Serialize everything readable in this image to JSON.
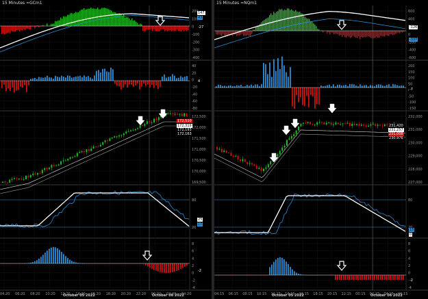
{
  "window": {
    "left_title": "15 Minutes =GCm1",
    "right_title": "15 Minutes =NQm1"
  },
  "left": {
    "axis_times": [
      "04:20",
      "06:20",
      "08:20",
      "10:20",
      "12:20",
      "14:20",
      "16:20",
      "18:20",
      "20:20",
      "22:20",
      "00:20",
      "02:20",
      "04:20"
    ],
    "dates": [
      "October 05 2022",
      "October 06 2022"
    ],
    "p1_ticks": [
      "200",
      "100",
      "0",
      "-100",
      "-200",
      "-300",
      "-400"
    ],
    "p1_tags": [
      "147",
      "43",
      "-27"
    ],
    "p2_ticks": [
      "40",
      "20",
      "0",
      "-20",
      "-40",
      "-60",
      "-80"
    ],
    "p2_tag": "4",
    "p3_ticks": [
      "172,500",
      "172,000",
      "171,500",
      "171,000",
      "170,500",
      "170,000",
      "169,500"
    ],
    "p3_tags": [
      "172,510",
      "172,319",
      "172,193",
      "172,163"
    ],
    "p4_ticks": [
      "80",
      "20"
    ],
    "p4_tags": [
      "25",
      "17"
    ],
    "p5_ticks": [
      "8",
      "6",
      "4",
      "2",
      "0",
      "-2",
      "-4"
    ],
    "p5_tag": "-2"
  },
  "right": {
    "axis_times": [
      "04:15",
      "06:15",
      "08:15",
      "10:15",
      "12:15",
      "14:15",
      "16:15",
      "18:15",
      "20:15",
      "22:15",
      "00:15",
      "02:15",
      "04:15",
      "06:15"
    ],
    "dates": [
      "October 05 2022",
      "October 06 2022"
    ],
    "p1_ticks": [
      "600",
      "400",
      "200",
      "0",
      "-200",
      "-400",
      "-600"
    ],
    "p1_tags": [
      "-126",
      "-337"
    ],
    "p2_ticks": [
      "200",
      "150",
      "100",
      "50",
      "0",
      "-50",
      "-100",
      "-150"
    ],
    "p2_tag": "-7",
    "p3_ticks": [
      "232,000",
      "231,000",
      "230,000",
      "229,000",
      "228,000",
      "227,000"
    ],
    "p3_tags": [
      "231,420",
      "231,257",
      "231,008",
      "230,976"
    ],
    "p4_ticks": [
      "80",
      "20"
    ],
    "p4_tags": [
      "15",
      "0"
    ],
    "p5_ticks": [
      "8",
      "6",
      "4",
      "2",
      "0",
      "-2",
      "-4"
    ],
    "p5_tag": "-2"
  },
  "colors": {
    "green": "#22bb22",
    "red": "#cc1111",
    "blue": "#2a8fd8",
    "white": "#ffffff",
    "grid": "#3a3a3a"
  }
}
